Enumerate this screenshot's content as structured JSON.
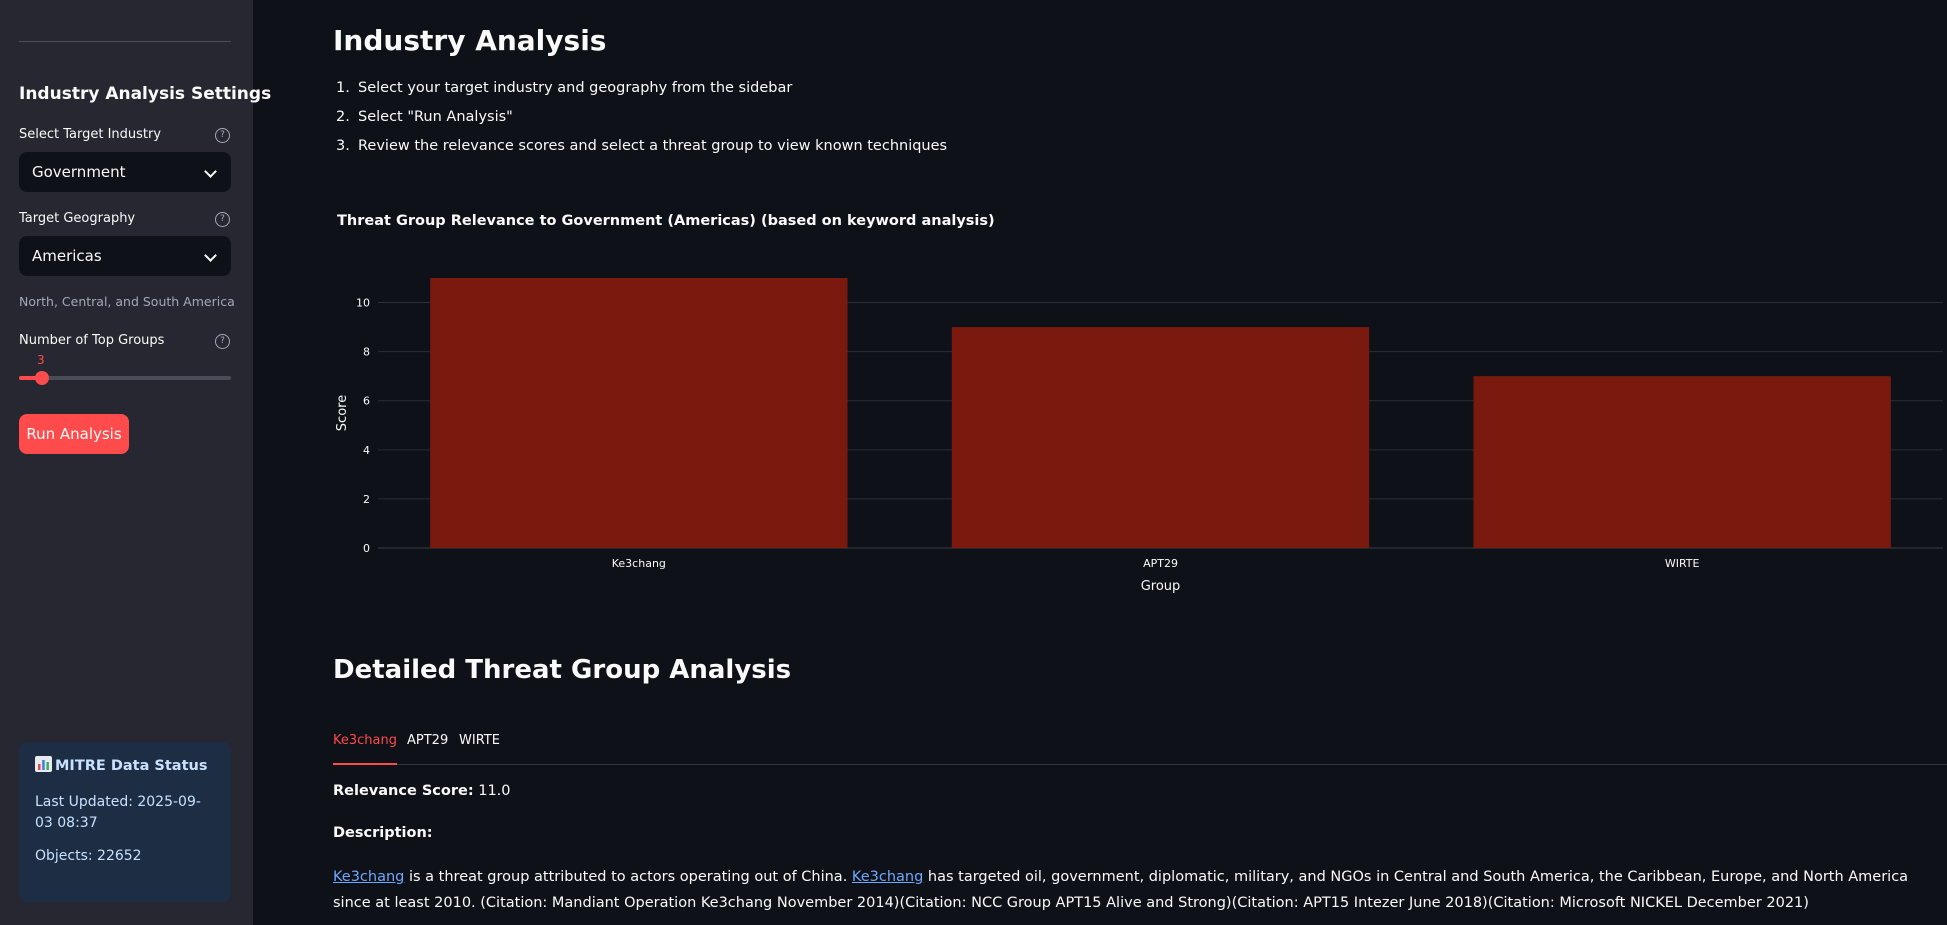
{
  "sidebar": {
    "title": "Industry Analysis Settings",
    "industry_label": "Select Target Industry",
    "industry_value": "Government",
    "geography_label": "Target Geography",
    "geography_value": "Americas",
    "geography_caption": "North, Central, and South America",
    "top_groups_label": "Number of Top Groups",
    "top_groups_value": "3",
    "run_button": "Run Analysis",
    "status": {
      "title": "MITRE Data Status",
      "last_updated": "Last Updated: 2025-09-03 08:37",
      "objects": "Objects: 22652"
    }
  },
  "main": {
    "title": "Industry Analysis",
    "steps": [
      {
        "num": "1.",
        "text": "Select your target industry and geography from the sidebar"
      },
      {
        "num": "2.",
        "text": "Select \"Run Analysis\""
      },
      {
        "num": "3.",
        "text": "Review the relevance scores and select a threat group to view known techniques"
      }
    ],
    "detail_title": "Detailed Threat Group Analysis",
    "tabs": [
      "Ke3chang",
      "APT29",
      "WIRTE"
    ],
    "relevance_label": "Relevance Score:",
    "relevance_value": "11.0",
    "description_label": "Description:",
    "description": {
      "link1": "Ke3chang",
      "part1": " is a threat group attributed to actors operating out of China. ",
      "link2": "Ke3chang",
      "part2": " has targeted oil, government, diplomatic, military, and NGOs in Central and South America, the Caribbean, Europe, and North America since at least 2010. (Citation: Mandiant Operation Ke3chang November 2014)(Citation: NCC Group APT15 Alive and Strong)(Citation: APT15 Intezer June 2018)(Citation: Microsoft NICKEL December 2021)"
    }
  },
  "chart_data": {
    "type": "bar",
    "title": "Threat Group Relevance to Government (Americas) (based on keyword analysis)",
    "categories": [
      "Ke3chang",
      "APT29",
      "WIRTE"
    ],
    "values": [
      11,
      9,
      7
    ],
    "xlabel": "Group",
    "ylabel": "Score",
    "ylim": [
      0,
      11
    ],
    "yticks": [
      0,
      2,
      4,
      6,
      8,
      10
    ],
    "bar_color": "#7a1a0f",
    "grid": true
  },
  "colors": {
    "accent": "#ff4b4b",
    "link": "#6fa8ff",
    "status_bg": "#1c2d44"
  }
}
